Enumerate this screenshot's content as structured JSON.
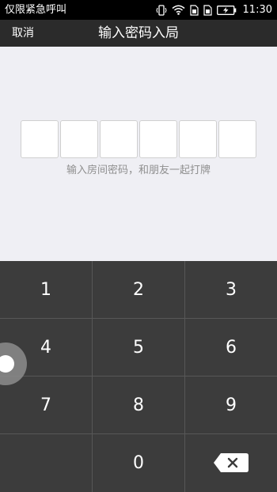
{
  "status_bar": {
    "carrier_text": "仅限紧急呼叫",
    "icons": [
      "vibrate-icon",
      "wifi-icon",
      "sim1-icon",
      "sim2-icon",
      "battery-charging-icon"
    ],
    "time": "11:30"
  },
  "nav": {
    "cancel_label": "取消",
    "title": "输入密码入局"
  },
  "pin": {
    "length": 6,
    "entered": "",
    "hint": "输入房间密码，和朋友一起打牌"
  },
  "keypad": {
    "keys": [
      "1",
      "2",
      "3",
      "4",
      "5",
      "6",
      "7",
      "8",
      "9",
      "",
      "0",
      "backspace"
    ]
  },
  "colors": {
    "status_bar_bg": "#000000",
    "nav_bg": "#2b2b2b",
    "content_bg": "#efeff4",
    "keypad_bg": "#3c3c3c",
    "hint_text": "#8f8f8f"
  }
}
